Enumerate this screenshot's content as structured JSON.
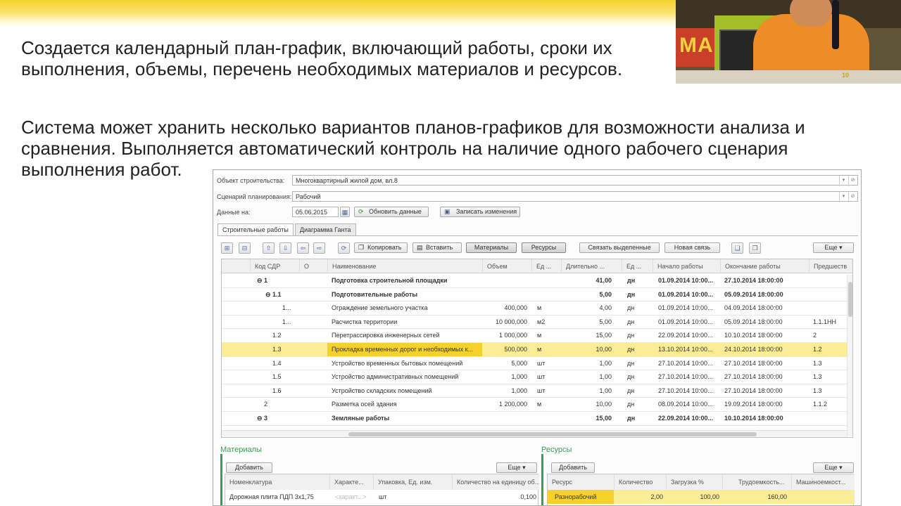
{
  "slide": {
    "paragraph1": "Создается календарный план-график, включающий работы, сроки их выполнения, объемы, перечень необходимых материалов и ресурсов.",
    "paragraph2": "Система может хранить несколько вариантов планов-графиков для возможности анализа и сравнения.  Выполняется автоматический контроль на наличие одного рабочего сценария выполнения работ.",
    "webcam_banner": "МА",
    "webcam_badge": "10"
  },
  "form": {
    "object_label": "Объект строительства:",
    "object_value": "Многоквартирный жилой дом, вл.8",
    "scenario_label": "Сценарий планирования:",
    "scenario_value": "Рабочий",
    "date_label": "Данные на:",
    "date_value": "05.06.2015",
    "refresh_label": "Обновить данные",
    "save_label": "Записать изменения"
  },
  "tabs": [
    {
      "label": "Строительные работы"
    },
    {
      "label": "Диаграмма Ганта"
    }
  ],
  "toolbar": {
    "copy": "Копировать",
    "paste": "Вставить",
    "materials": "Материалы",
    "resources": "Ресурсы",
    "link_selected": "Связать выделенные",
    "new_link": "Новая связь",
    "more": "Еще"
  },
  "grid": {
    "headers": [
      "Код СДР",
      "О",
      "Наименование",
      "Объем",
      "Ед ...",
      "Длительно ...",
      "Ед ...",
      "Начало работы",
      "Окончание работы",
      "Предшеств"
    ],
    "rows": [
      {
        "code": "⊖ 1",
        "name": "Подготовка строительной площадки",
        "vol": "",
        "unit": "",
        "dur": "41,00",
        "dunit": "дн",
        "start": "01.09.2014 10:00...",
        "end": "27.10.2014 18:00:00",
        "pred": "",
        "bold": true
      },
      {
        "code": "⊖ 1.1",
        "name": "Подготовительные работы",
        "vol": "",
        "unit": "",
        "dur": "5,00",
        "dunit": "дн",
        "start": "01.09.2014 10:00...",
        "end": "05.09.2014 18:00:00",
        "pred": "",
        "bold": true
      },
      {
        "code": "1...",
        "name": "Ограждение земельного участка",
        "vol": "400,000",
        "unit": "м",
        "dur": "4,00",
        "dunit": "дн",
        "start": "01.09.2014 10:00...",
        "end": "04.09.2014 18:00:00",
        "pred": ""
      },
      {
        "code": "1...",
        "name": "Расчистка территории",
        "vol": "10 000,000",
        "unit": "м2",
        "dur": "5,00",
        "dunit": "дн",
        "start": "01.09.2014 10:00...",
        "end": "05.09.2014 18:00:00",
        "pred": "1.1.1НН"
      },
      {
        "code": "1.2",
        "name": "Перетрассировка инженерных сетей",
        "vol": "1 000,000",
        "unit": "м",
        "dur": "15,00",
        "dunit": "дн",
        "start": "22.09.2014 10:00...",
        "end": "10.10.2014 18:00:00",
        "pred": "2"
      },
      {
        "code": "1.3",
        "name": "Прокладка временных дорог и необходимых к...",
        "vol": "500,000",
        "unit": "м",
        "dur": "10,00",
        "dunit": "дн",
        "start": "13.10.2014 10:00...",
        "end": "24.10.2014 18:00:00",
        "pred": "1.2",
        "selected": true
      },
      {
        "code": "1.4",
        "name": "Устройство временных бытовых помещений",
        "vol": "5,000",
        "unit": "шт",
        "dur": "1,00",
        "dunit": "дн",
        "start": "27.10.2014 10:00...",
        "end": "27.10.2014 18:00:00",
        "pred": "1.3"
      },
      {
        "code": "1.5",
        "name": "Устройство административных помещений",
        "vol": "1,000",
        "unit": "шт",
        "dur": "1,00",
        "dunit": "дн",
        "start": "27.10.2014 10:00...",
        "end": "27.10.2014 18:00:00",
        "pred": "1.3"
      },
      {
        "code": "1.6",
        "name": "Устройство складских помещений",
        "vol": "1,000",
        "unit": "шт",
        "dur": "1,00",
        "dunit": "дн",
        "start": "27.10.2014 10:00...",
        "end": "27.10.2014 18:00:00",
        "pred": "1.3"
      },
      {
        "code": "2",
        "name": "Разметка осей здания",
        "vol": "1 200,000",
        "unit": "м",
        "dur": "10,00",
        "dunit": "дн",
        "start": "08.09.2014 10:00...",
        "end": "19.09.2014 18:00:00",
        "pred": "1.1.2"
      },
      {
        "code": "⊖ 3",
        "name": "Земляные работы",
        "vol": "",
        "unit": "",
        "dur": "15,00",
        "dunit": "дн",
        "start": "22.09.2014 10:00...",
        "end": "10.10.2014 18:00:00",
        "pred": "",
        "bold": true
      }
    ]
  },
  "materials": {
    "title": "Материалы",
    "add": "Добавить",
    "more": "Еще",
    "headers": [
      "Номенклатура",
      "Характе...",
      "Упаковка, Ед. изм.",
      "Количество на единицу об..."
    ],
    "row": {
      "name": "Дорожная плита ПДП 3х1,75",
      "char": "<характ...>",
      "unit": "шт",
      "qty": "0,100"
    }
  },
  "resources": {
    "title": "Ресурсы",
    "add": "Добавить",
    "more": "Еще",
    "headers": [
      "Ресурс",
      "Количество",
      "Загрузка %",
      "Трудоемкость...",
      "Машиноемкост..."
    ],
    "row": {
      "name": "Разнорабочий",
      "qty": "2,00",
      "load": "100,00",
      "labor": "160,00",
      "machine": ""
    }
  }
}
